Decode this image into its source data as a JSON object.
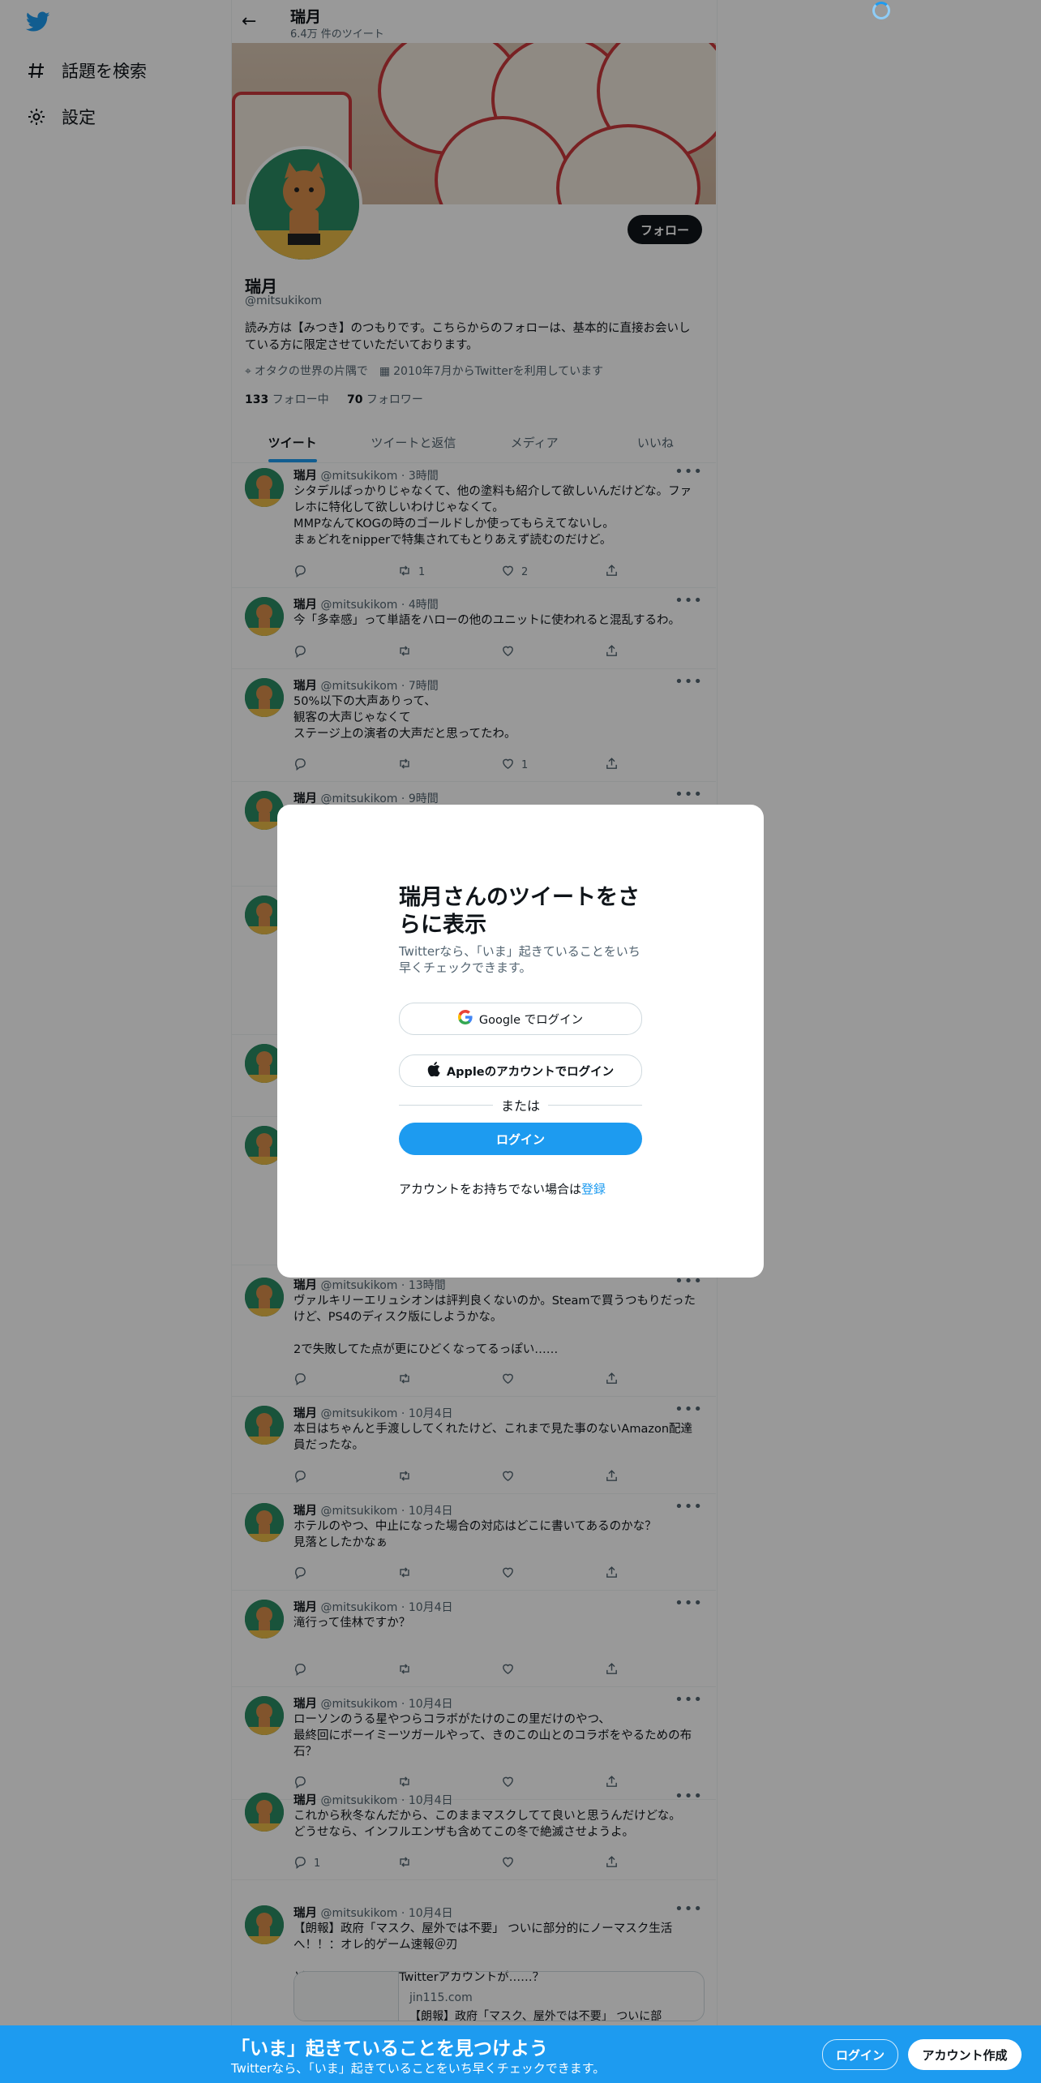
{
  "nav": {
    "items": [
      {
        "icon": "hash-icon",
        "label": "話題を検索"
      },
      {
        "icon": "gear-icon",
        "label": "設定"
      }
    ]
  },
  "header": {
    "title": "瑞月",
    "subtitle": "6.4万 件のツイート"
  },
  "profile": {
    "name": "瑞月",
    "handle": "@mitsukikom",
    "follow_label": "フォロー",
    "bio": "読み方は【みつき】のつもりです。こちらからのフォローは、基本的に直接お会いしている方に限定させていただいております。",
    "location": "オタクの世界の片隅で",
    "joined": "2010年7月からTwitterを利用しています",
    "following_count": "133",
    "following_label": "フォロー中",
    "followers_count": "70",
    "followers_label": "フォロワー"
  },
  "tabs": [
    "ツイート",
    "ツイートと返信",
    "メディア",
    "いいね"
  ],
  "tweets": [
    {
      "name": "瑞月",
      "handle": "@mitsukikom",
      "time": "3時間",
      "text": "シタデルばっかりじゃなくて、他の塗料も紹介して欲しいんだけどな。ファレホに特化して欲しいわけじゃなくて。\nMMPなんてKOGの時のゴールドしか使ってもらえてないし。\nまぁどれをnipperで特集されてもとりあえず読むのだけど。",
      "replies": "",
      "retweets": "1",
      "likes": "2"
    },
    {
      "name": "瑞月",
      "handle": "@mitsukikom",
      "time": "4時間",
      "text": "今「多幸感」って単語をハローの他のユニットに使われると混乱するわ。",
      "replies": "",
      "retweets": "",
      "likes": ""
    },
    {
      "name": "瑞月",
      "handle": "@mitsukikom",
      "time": "7時間",
      "text": "50%以下の大声ありって、\n観客の大声じゃなくて\nステージ上の演者の大声だと思ってたわ。",
      "replies": "",
      "retweets": "",
      "likes": "1"
    },
    {
      "name": "瑞月",
      "handle": "@mitsukikom",
      "time": "9時間",
      "text": "",
      "replies": "",
      "retweets": "",
      "likes": ""
    },
    {
      "name": "瑞月",
      "handle": "@mitsukikom",
      "time": "13時間",
      "text": "ヴァルキリーエリュシオンは評判良くないのか。Steamで買うつもりだったけど、PS4のディスク版にしようかな。\n\n2で失敗してた点が更にひどくなってるっぽい……",
      "replies": "",
      "retweets": "",
      "likes": ""
    },
    {
      "name": "瑞月",
      "handle": "@mitsukikom",
      "time": "10月4日",
      "text": "本日はちゃんと手渡ししてくれたけど、これまで見た事のないAmazon配達員だったな。",
      "replies": "",
      "retweets": "",
      "likes": ""
    },
    {
      "name": "瑞月",
      "handle": "@mitsukikom",
      "time": "10月4日",
      "text": "ホテルのやつ、中止になった場合の対応はどこに書いてあるのかな？\n見落としたかなぁ",
      "replies": "",
      "retweets": "",
      "likes": ""
    },
    {
      "name": "瑞月",
      "handle": "@mitsukikom",
      "time": "10月4日",
      "text": "滝行って佳林ですか？",
      "replies": "",
      "retweets": "",
      "likes": ""
    },
    {
      "name": "瑞月",
      "handle": "@mitsukikom",
      "time": "10月4日",
      "text": "ローソンのうる星やつらコラボがたけのこの里だけのやつ、\n最終回にボーイミーツガールやって、きのこの山とのコラボをやるための布石？",
      "replies": "",
      "retweets": "",
      "likes": ""
    },
    {
      "name": "瑞月",
      "handle": "@mitsukikom",
      "time": "10月4日",
      "text": "これから秋冬なんだから、このままマスクしてて良いと思うんだけどな。\nどうせなら、インフルエンザも含めてこの冬で絶滅させようよ。",
      "replies": "1",
      "retweets": "",
      "likes": ""
    },
    {
      "name": "瑞月",
      "handle": "@mitsukikom",
      "time": "10月4日",
      "text": "【朗報】政府「マスク、屋外では不要」 ついに部分的にノーマスク生活へ！！：オレ的ゲーム速報＠刃\n\nどこかで見たようなTwitterアカウントが……？",
      "replies": "",
      "retweets": "",
      "likes": "",
      "card_domain": "jin115.com",
      "card_title": "【朗報】政府「マスク、屋外では不要」 ついに部"
    }
  ],
  "modal": {
    "title": "瑞月さんのツイートをさらに表示",
    "subtitle": "Twitterなら、「いま」起きていることをいち早くチェックできます。",
    "google_label": "Google でログイン",
    "apple_label": "Appleのアカウントでログイン",
    "or_label": "または",
    "login_label": "ログイン",
    "no_account": "アカウントをお持ちでない場合は",
    "signup_link": "登録"
  },
  "bottom_bar": {
    "headline": "「いま」起きていることを見つけよう",
    "sub": "Twitterなら、「いま」起きていることをいち早くチェックできます。",
    "login_label": "ログイン",
    "signup_label": "アカウント作成"
  },
  "colors": {
    "accent": "#1d9bf0",
    "text": "#0f1419",
    "muted": "#536471",
    "overlay": "rgba(0,0,0,0.4)"
  }
}
